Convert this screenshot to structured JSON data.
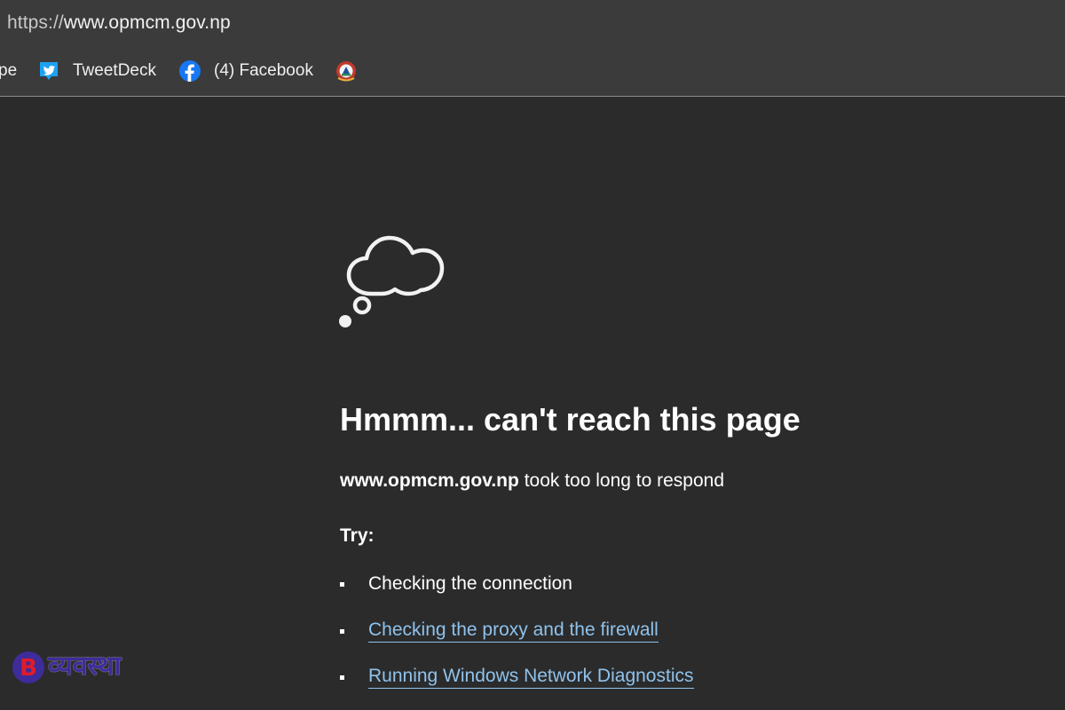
{
  "address_bar": {
    "protocol": "https://",
    "host": "www.opmcm.gov.np"
  },
  "bookmarks": [
    {
      "label": "pe",
      "icon": "partial-bookmark"
    },
    {
      "label": "TweetDeck",
      "icon": "twitter-icon"
    },
    {
      "label": "(4) Facebook",
      "icon": "facebook-icon"
    },
    {
      "label": "",
      "icon": "government-emblem-icon"
    }
  ],
  "error": {
    "title": "Hmmm... can't reach this page",
    "host": "www.opmcm.gov.np",
    "message": "took too long to respond",
    "try_label": "Try:",
    "suggestions": [
      {
        "text": "Checking the connection",
        "link": false
      },
      {
        "text": "Checking the proxy and the firewall",
        "link": true
      },
      {
        "text": "Running Windows Network Diagnostics",
        "link": true
      }
    ]
  },
  "watermark": {
    "text": "व्यवस्था",
    "colors": {
      "primary": "#3d2c9a",
      "accent": "#e11b2a"
    }
  },
  "colors": {
    "background": "#2b2b2b",
    "toolbar": "#3b3b3b",
    "link": "#8fc2ec"
  }
}
